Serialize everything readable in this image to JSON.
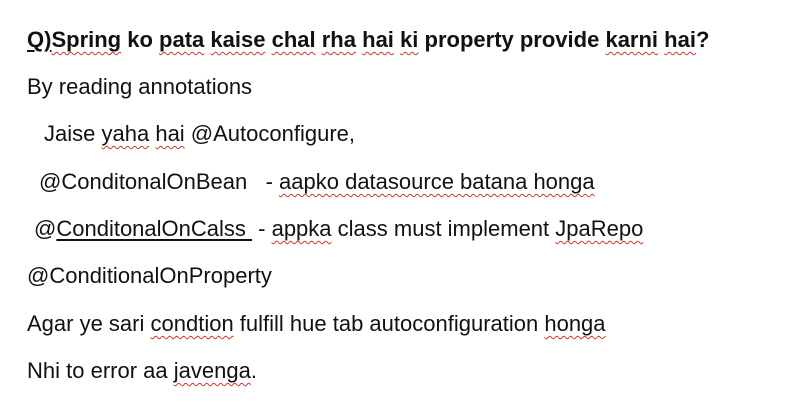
{
  "question": {
    "prefix": "Q)",
    "w1": "Spring",
    "s1": " ko ",
    "w2": "pata",
    "s2": " ",
    "w3": "kaise",
    "s3": " ",
    "w4": "chal",
    "s4": " ",
    "w5": "rha",
    "s5": " ",
    "w6": "hai",
    "s6": " ",
    "w7": "ki",
    "s7": " property provide ",
    "w8": "karni",
    "s8": " ",
    "w9": "hai",
    "end": "?"
  },
  "answer": "By reading annotations",
  "line3": {
    "a": "Jaise ",
    "b": "yaha",
    "c": " ",
    "d": "hai",
    "e": " @Autoconfigure,"
  },
  "line4": {
    "a": "@ConditonalOnBean   - ",
    "b": "aapko datasource batana honga"
  },
  "line5": {
    "a": "@",
    "b": "ConditonalOnCalss ",
    "c": " - ",
    "d": "appka",
    "e": " class must implement ",
    "f": "JpaRepo"
  },
  "line6": "@ConditionalOnProperty",
  "line7": {
    "a": "Agar ye sari ",
    "b": "condtion",
    "c": " fulfill hue tab autoconfiguration ",
    "d": "honga"
  },
  "line8": {
    "a": "Nhi to error aa ",
    "b": "javenga",
    "c": "."
  }
}
